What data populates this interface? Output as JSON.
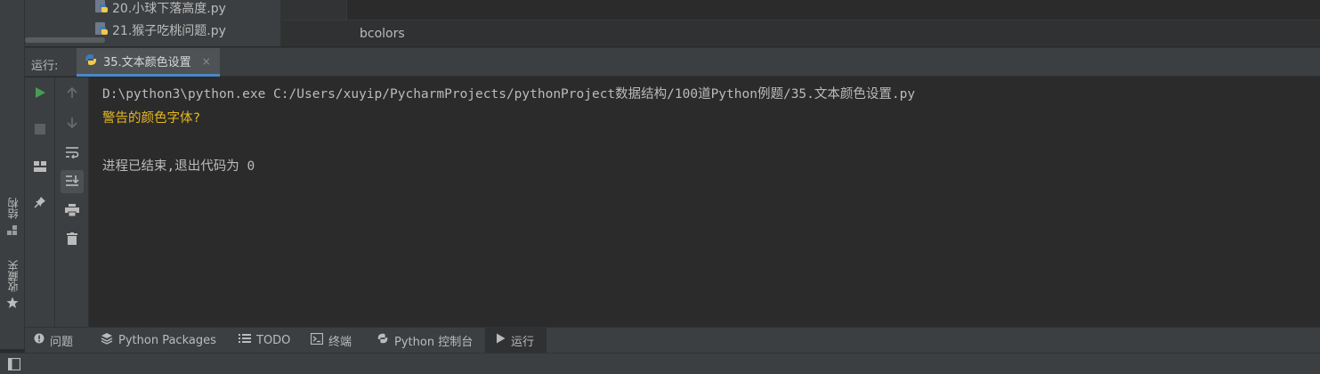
{
  "project_tree": {
    "items": [
      {
        "label": "20.小球下落高度.py",
        "icon": "python-file-icon"
      },
      {
        "label": "21.猴子吃桃问题.py",
        "icon": "python-file-icon"
      }
    ]
  },
  "editor": {
    "breadcrumb": "bcolors"
  },
  "left_strip": {
    "structure_label": "结构",
    "favorites_label": "收藏夹"
  },
  "run_panel": {
    "title": "运行:",
    "tab_label": "35.文本颜色设置",
    "tab_close": "×",
    "toolbar_left": [
      "run-icon",
      "stop-icon",
      "layout-icon",
      "pin-icon"
    ],
    "toolbar_right": [
      "up-arrow-icon",
      "down-arrow-icon",
      "soft-wrap-icon",
      "scroll-to-end-icon",
      "print-icon",
      "trash-icon"
    ]
  },
  "console": {
    "command_line": "D:\\python3\\python.exe C:/Users/xuyip/PycharmProjects/pythonProject数据结构/100道Python例题/35.文本颜色设置.py",
    "warning_line": "警告的颜色字体?",
    "exit_line": "进程已结束,退出代码为 0"
  },
  "bottom_tabs": [
    {
      "label": "问题",
      "icon": "problems-icon"
    },
    {
      "label": "Python Packages",
      "icon": "layers-icon"
    },
    {
      "label": "TODO",
      "icon": "list-icon"
    },
    {
      "label": "终端",
      "icon": "terminal-icon"
    },
    {
      "label": "Python 控制台",
      "icon": "python-console-icon"
    },
    {
      "label": "运行",
      "icon": "run-icon"
    }
  ],
  "colors": {
    "warning_text": "#e6b81f",
    "run_green": "#499c54",
    "accent": "#4a88c7"
  }
}
